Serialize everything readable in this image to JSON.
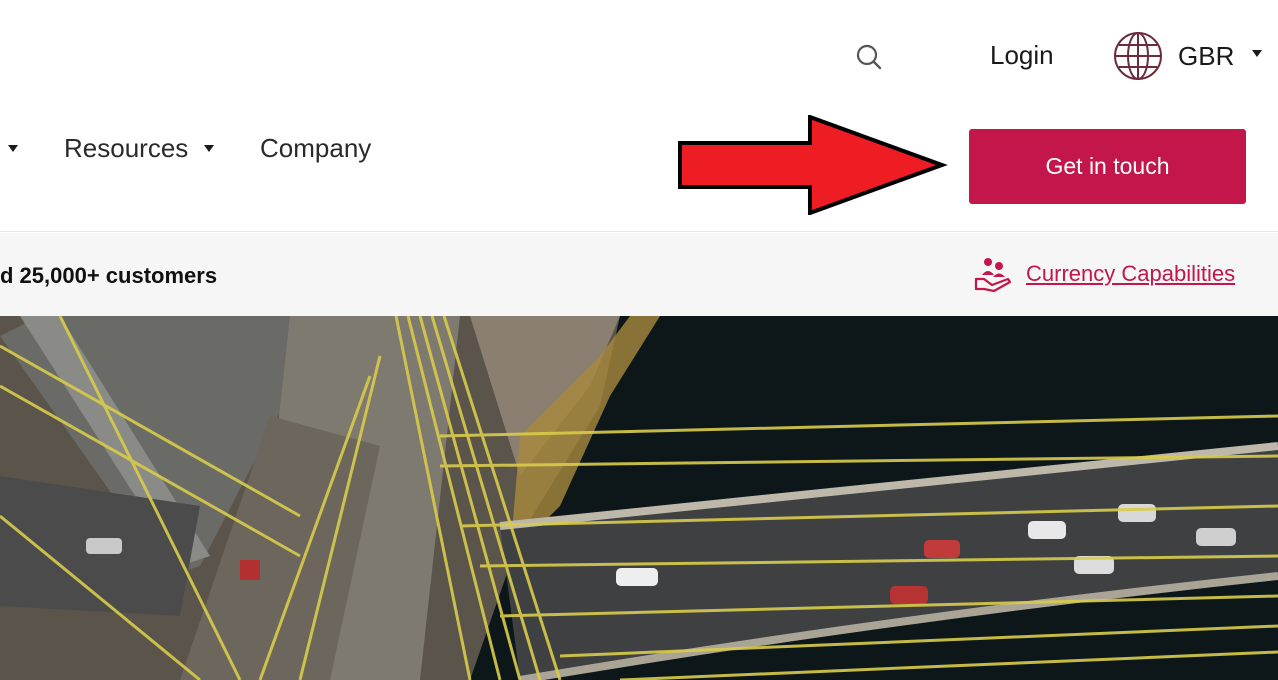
{
  "header": {
    "search_icon": "search-icon",
    "login_label": "Login",
    "locale": {
      "icon": "globe-icon",
      "label": "GBR"
    }
  },
  "nav": {
    "items": [
      {
        "label": "Resources",
        "has_dropdown": true
      },
      {
        "label": "Company",
        "has_dropdown": false
      }
    ],
    "cta_label": "Get in touch"
  },
  "annotation": {
    "arrow_color": "#ee1d23"
  },
  "strip": {
    "text": "d 25,000+ customers",
    "link_label": "Currency Capabilities",
    "link_icon": "hand-people-icon"
  },
  "hero": {
    "image": "aerial-bridge-photo"
  },
  "colors": {
    "accent": "#c3164b",
    "strip_bg": "#f6f6f6",
    "text": "#1a1a1a"
  }
}
